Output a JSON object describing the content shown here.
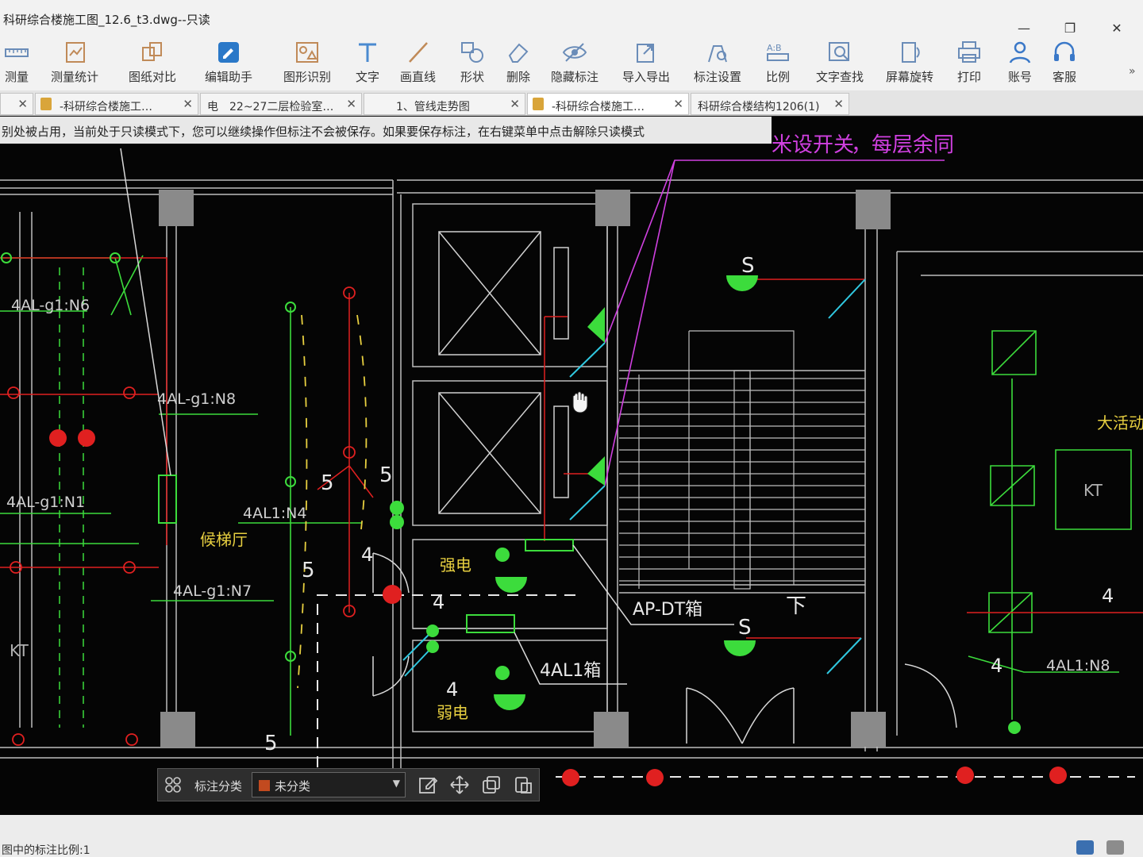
{
  "window": {
    "title": "科研综合楼施工图_12.6_t3.dwg--只读",
    "minimize": "—",
    "maximize": "❐",
    "close": "✕"
  },
  "toolbar": {
    "items": [
      {
        "label": "测量",
        "icon": "ruler-icon"
      },
      {
        "label": "测量统计",
        "icon": "measure-stats-icon"
      },
      {
        "label": "图纸对比",
        "icon": "compare-icon"
      },
      {
        "label": "编辑助手",
        "icon": "edit-assistant-icon"
      },
      {
        "label": "图形识别",
        "icon": "shape-recognition-icon"
      },
      {
        "label": "文字",
        "icon": "text-icon"
      },
      {
        "label": "画直线",
        "icon": "line-icon"
      },
      {
        "label": "形状",
        "icon": "shapes-icon"
      },
      {
        "label": "删除",
        "icon": "eraser-icon"
      },
      {
        "label": "隐藏标注",
        "icon": "eye-hide-icon"
      },
      {
        "label": "导入导出",
        "icon": "import-export-icon"
      },
      {
        "label": "标注设置",
        "icon": "annotation-settings-icon"
      },
      {
        "label": "比例",
        "icon": "scale-icon"
      },
      {
        "label": "文字查找",
        "icon": "text-search-icon"
      },
      {
        "label": "屏幕旋转",
        "icon": "rotate-screen-icon"
      },
      {
        "label": "打印",
        "icon": "print-icon"
      },
      {
        "label": "账号",
        "icon": "account-icon"
      },
      {
        "label": "客服",
        "icon": "headset-icon"
      }
    ],
    "more": "»"
  },
  "tabs": [
    {
      "label": "",
      "locked": false
    },
    {
      "label": "-科研综合楼施工…",
      "locked": true
    },
    {
      "label": "电　22~27二层检验室…",
      "locked": false
    },
    {
      "label": "1、管线走势图",
      "locked": false
    },
    {
      "label": "-科研综合楼施工…",
      "locked": true
    },
    {
      "label": "科研综合楼结构1206(1)",
      "locked": false
    }
  ],
  "notice": "别处被占用，当前处于只读模式下，您可以继续操作但标注不会被保存。如果要保存标注，在右键菜单中点击解除只读模式",
  "drawing": {
    "annotations_top": [
      "米设开关",
      "，每层余同"
    ],
    "labels": {
      "n6": "4AL-g1:N6",
      "n8": "4AL-g1:N8",
      "n1": "4AL-g1:N1",
      "n4": "4AL1:N4",
      "n7": "4AL-g1:N7",
      "n8r": "4AL1:N8",
      "lobby": "候梯厅",
      "strong": "强电",
      "weak": "弱电",
      "ap_box": "AP-DT箱",
      "al1_box": "4AL1箱",
      "activity": "大活动室",
      "kt_left": "KT",
      "kt_right": "KT",
      "s1": "S",
      "s2": "S",
      "down": "下",
      "d5a": "5",
      "d5b": "5",
      "d5c": "5",
      "d5d": "5",
      "d4a": "4",
      "d4b": "4",
      "d4c": "4",
      "d4d": "4",
      "d4e": "4"
    }
  },
  "annotation_bar": {
    "category_label": "标注分类",
    "selected": "未分类",
    "swatch_color": "#c24a1f"
  },
  "status": {
    "text": "图中的标注比例:1"
  },
  "colors": {
    "cad_bg": "#050505",
    "cad_white": "#e8e8e8",
    "cad_green": "#3cdc3c",
    "cad_red": "#e02020",
    "cad_magenta": "#d040e0",
    "cad_cyan": "#30c8e0",
    "cad_yellow": "#e8d040",
    "cad_gray": "#8a8a8a"
  }
}
